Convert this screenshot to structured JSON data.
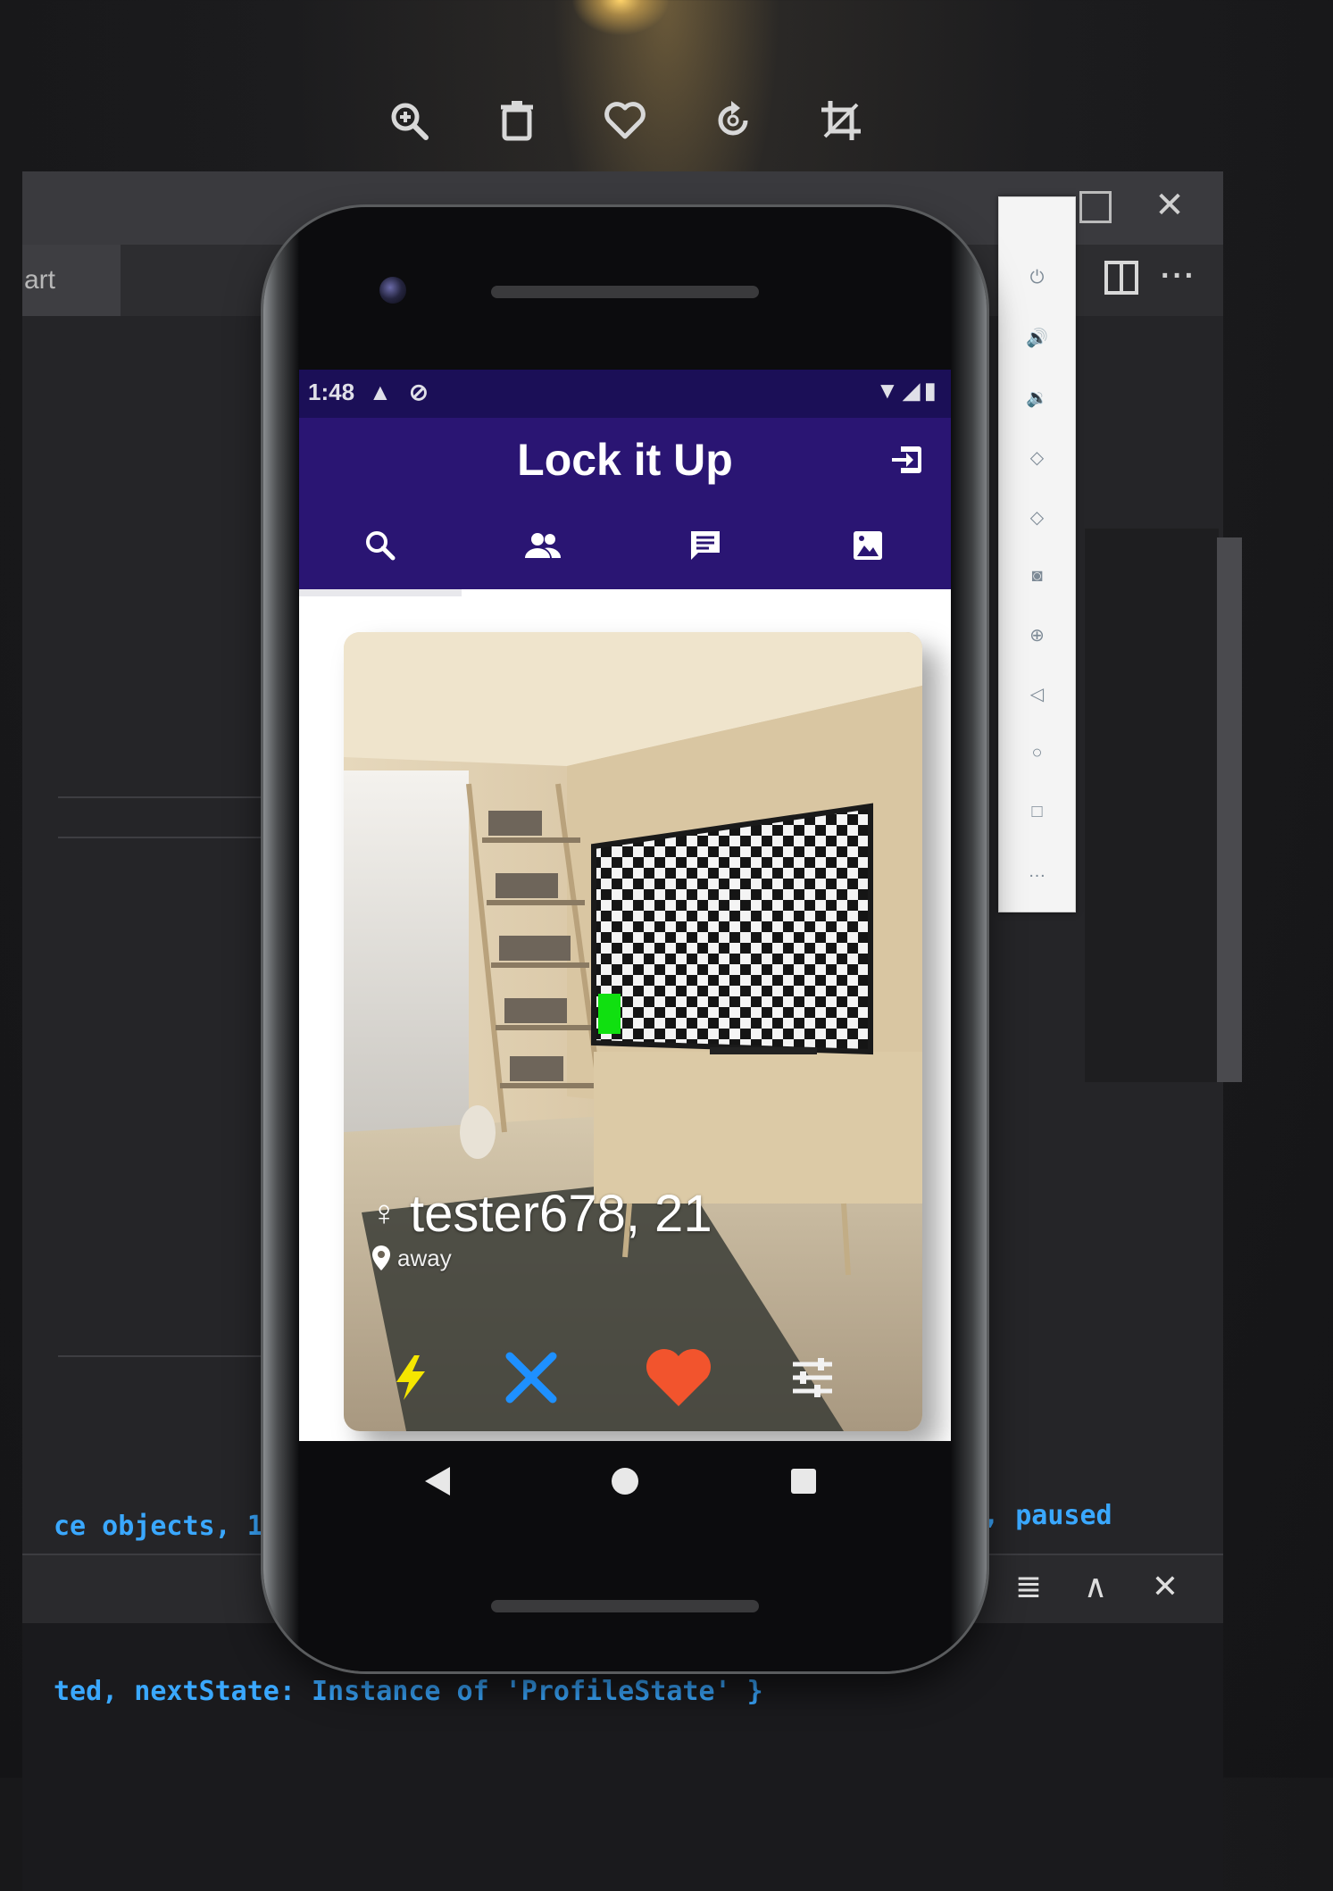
{
  "viewer_toolbar": {
    "icons": [
      "zoom-in-icon",
      "trash-icon",
      "heart-outline-icon",
      "rotate-icon",
      "crop-icon"
    ]
  },
  "ide": {
    "tab_label": "art",
    "window_close": "✕",
    "more_label": "···",
    "panel_buttons": {
      "clear": "≣",
      "collapse": "∧",
      "close": "✕"
    },
    "console_lines": [
      {
        "left": "ce objects, 11",
        "right": "KB, paused"
      },
      {
        "left": "ted, nextState: Instance of 'ProfileState' }"
      }
    ]
  },
  "emulator_sidebar": {
    "tools": [
      "power-icon",
      "volume-up-icon",
      "volume-down-icon",
      "rotate-left-icon",
      "rotate-right-icon",
      "camera-icon",
      "zoom-icon",
      "back-icon",
      "home-icon",
      "overview-icon",
      "more-icon"
    ]
  },
  "status_bar": {
    "time": "1:48",
    "left_icons": "▲ ⊘",
    "right_icons": "▼◢▮"
  },
  "app_bar": {
    "title": "Lock it Up"
  },
  "tabs": [
    {
      "icon": "search-icon",
      "selected": true
    },
    {
      "icon": "people-icon",
      "selected": false
    },
    {
      "icon": "chat-icon",
      "selected": false
    },
    {
      "icon": "image-icon",
      "selected": false
    }
  ],
  "profile_card": {
    "gender_symbol": "♀",
    "name": "tester678, 21",
    "status": "away"
  },
  "card_actions": [
    "flash-icon",
    "dislike-x-icon",
    "like-heart-icon",
    "filters-icon"
  ],
  "colors": {
    "primary_dark": "#1b0f57",
    "primary": "#2a1573",
    "flash": "#f5e600",
    "dislike": "#1e90ff",
    "like": "#f2542d"
  }
}
